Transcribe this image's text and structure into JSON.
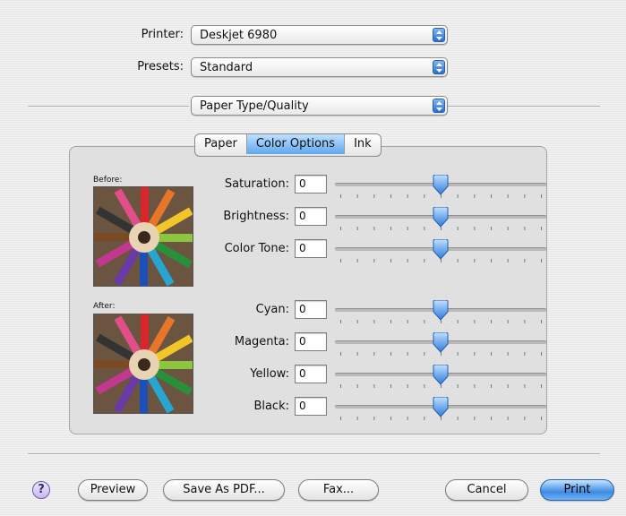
{
  "printer": {
    "label": "Printer:",
    "value": "Deskjet 6980"
  },
  "presets": {
    "label": "Presets:",
    "value": "Standard"
  },
  "panel": {
    "value": "Paper Type/Quality"
  },
  "tabs": [
    {
      "label": "Paper",
      "selected": false
    },
    {
      "label": "Color Options",
      "selected": true
    },
    {
      "label": "Ink",
      "selected": false
    }
  ],
  "preview": {
    "before_label": "Before:",
    "after_label": "After:"
  },
  "sliders": [
    {
      "label": "Saturation:",
      "value": "0",
      "position": 0.5
    },
    {
      "label": "Brightness:",
      "value": "0",
      "position": 0.5
    },
    {
      "label": "Color Tone:",
      "value": "0",
      "position": 0.5
    },
    {
      "label": "Cyan:",
      "value": "0",
      "position": 0.5
    },
    {
      "label": "Magenta:",
      "value": "0",
      "position": 0.5
    },
    {
      "label": "Yellow:",
      "value": "0",
      "position": 0.5
    },
    {
      "label": "Black:",
      "value": "0",
      "position": 0.5
    }
  ],
  "buttons": {
    "help": "?",
    "preview": "Preview",
    "save_pdf": "Save As PDF...",
    "fax": "Fax...",
    "cancel": "Cancel",
    "print": "Print"
  },
  "colors": {
    "accent": "#3d8be2",
    "selected_tab": "#5fa7ee"
  }
}
